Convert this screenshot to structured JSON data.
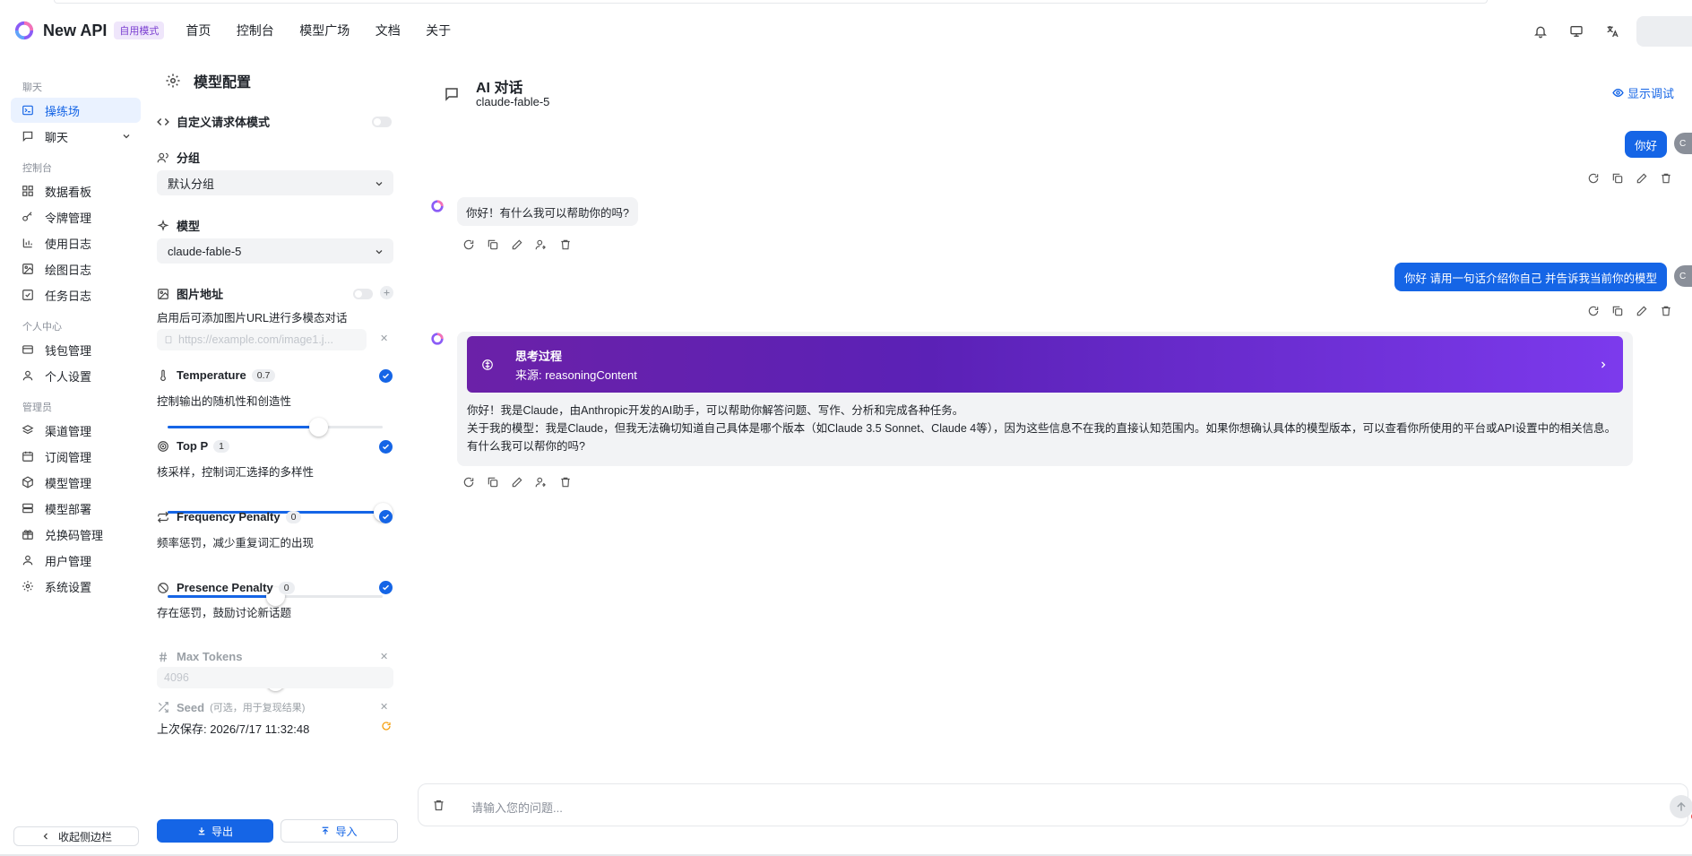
{
  "header": {
    "brand": "New API",
    "mode_badge": "自用模式",
    "nav": [
      "首页",
      "控制台",
      "模型广场",
      "文档",
      "关于"
    ]
  },
  "sidebar": {
    "sections": {
      "chat": "聊天",
      "console": "控制台",
      "personal": "个人中心",
      "admin": "管理员"
    },
    "items": {
      "playground": "操练场",
      "chat": "聊天",
      "dashboard": "数据看板",
      "tokens": "令牌管理",
      "usage_log": "使用日志",
      "draw_log": "绘图日志",
      "task_log": "任务日志",
      "wallet": "钱包管理",
      "profile": "个人设置",
      "channels": "渠道管理",
      "subscriptions": "订阅管理",
      "models": "模型管理",
      "deploy": "模型部署",
      "redeem": "兑换码管理",
      "users": "用户管理",
      "settings": "系统设置"
    },
    "collapse": "收起侧边栏"
  },
  "config": {
    "title": "模型配置",
    "custom_body": "自定义请求体模式",
    "group_label": "分组",
    "group_value": "默认分组",
    "model_label": "模型",
    "model_value": "claude-fable-5",
    "image_label": "图片地址",
    "image_desc": "启用后可添加图片URL进行多模态对话",
    "image_placeholder": "https://example.com/image1.j...",
    "temperature": {
      "label": "Temperature",
      "value": "0.7",
      "desc": "控制输出的随机性和创造性",
      "level": 0.7
    },
    "top_p": {
      "label": "Top P",
      "value": "1",
      "desc": "核采样，控制词汇选择的多样性",
      "level": 1.0
    },
    "freq": {
      "label": "Frequency Penalty",
      "value": "0",
      "desc": "频率惩罚，减少重复词汇的出现",
      "level": 0.5
    },
    "presence": {
      "label": "Presence Penalty",
      "value": "0",
      "desc": "存在惩罚，鼓励讨论新话题",
      "level": 0.5
    },
    "max_tokens_label": "Max Tokens",
    "max_tokens_placeholder": "4096",
    "seed_label": "Seed",
    "seed_hint": "(可选，用于复现结果)",
    "last_saved": "上次保存: 2026/7/17 11:32:48",
    "export": "导出",
    "import": "导入"
  },
  "chat": {
    "title": "AI 对话",
    "model": "claude-fable-5",
    "debug": "显示调试",
    "user_avatar": "C",
    "messages": {
      "u1": "你好",
      "a1": "你好！有什么我可以帮助你的吗?",
      "u2": "你好 请用一句话介绍你自己 并告诉我当前你的模型",
      "think_title": "思考过程",
      "think_source": "来源: reasoningContent",
      "a2_l1": "你好！我是Claude，由Anthropic开发的AI助手，可以帮助你解答问题、写作、分析和完成各种任务。",
      "a2_l2": "关于我的模型：我是Claude，但我无法确切知道自己具体是哪个版本（如Claude 3.5 Sonnet、Claude 4等），因为这些信息不在我的直接认知范围内。如果你想确认具体的模型版本，可以查看你所使用的平台或API设置中的相关信息。",
      "a2_l3": "有什么我可以帮你的吗?"
    },
    "input_placeholder": "请输入您的问题..."
  }
}
